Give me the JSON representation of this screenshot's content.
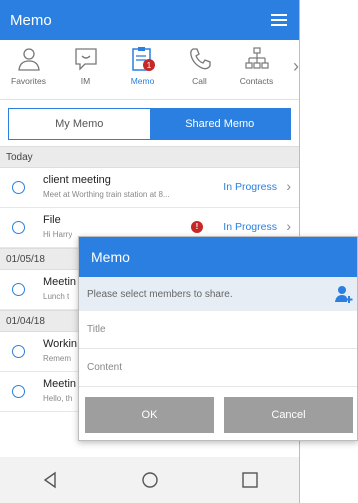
{
  "app": {
    "title": "Memo"
  },
  "nav": {
    "items": [
      {
        "label": "Favorites",
        "icon": "person-icon"
      },
      {
        "label": "IM",
        "icon": "chat-icon"
      },
      {
        "label": "Memo",
        "icon": "memo-icon",
        "active": true,
        "badge": "1"
      },
      {
        "label": "Call",
        "icon": "phone-icon"
      },
      {
        "label": "Contacts",
        "icon": "org-chart-icon"
      }
    ],
    "more": "›"
  },
  "segmented": {
    "left": "My Memo",
    "right": "Shared Memo",
    "selected": "right"
  },
  "sections": [
    {
      "label": "Today",
      "rows": [
        {
          "title": "client meeting",
          "subtitle": "Meet at Worthing train station at 8...",
          "status": "In Progress",
          "error": false
        },
        {
          "title": "File",
          "subtitle": "Hi Harry",
          "status": "In Progress",
          "error": true,
          "error_mark": "!"
        }
      ]
    },
    {
      "label": "01/05/18",
      "rows": [
        {
          "title": "Meetin",
          "subtitle": "Lunch t"
        }
      ]
    },
    {
      "label": "01/04/18",
      "rows": [
        {
          "title": "Workin",
          "subtitle": "Remem"
        },
        {
          "title": "Meetin",
          "subtitle": "Hello, th"
        }
      ]
    }
  ],
  "dialog": {
    "title": "Memo",
    "members_placeholder": "Please select members to share.",
    "title_placeholder": "Title",
    "content_placeholder": "Content",
    "ok": "OK",
    "cancel": "Cancel"
  },
  "colors": {
    "accent": "#2a7fe0",
    "error": "#c62828",
    "button_gray": "#9e9e9e"
  }
}
